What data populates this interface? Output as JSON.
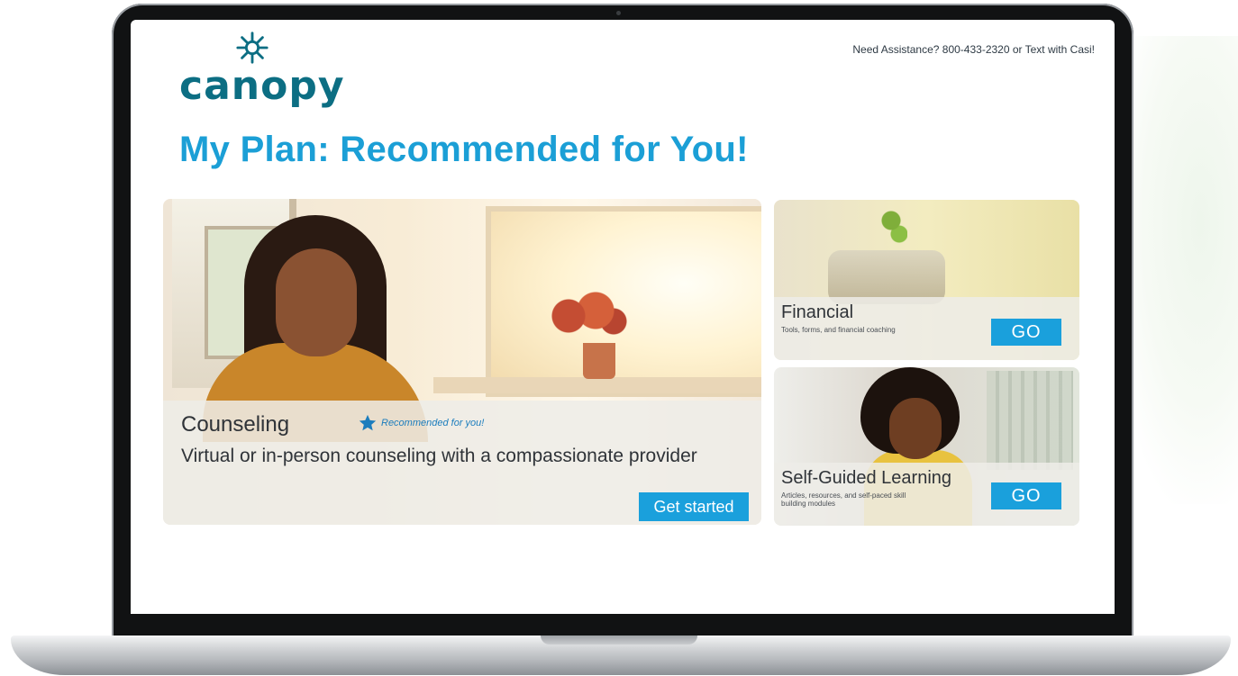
{
  "header": {
    "brand": "canopy",
    "assistance": "Need Assistance? 800-433-2320 or Text with Casi!"
  },
  "page_title": "My Plan: Recommended for You!",
  "cards": {
    "counseling": {
      "title": "Counseling",
      "badge": "Recommended for you!",
      "description": "Virtual or in-person counseling with a compassionate provider",
      "button": "Get started"
    },
    "financial": {
      "title": "Financial",
      "description": "Tools, forms, and financial coaching",
      "button": "GO"
    },
    "self_guided": {
      "title": "Self-Guided Learning",
      "description": "Articles, resources, and self-paced skill building modules",
      "button": "GO"
    }
  },
  "icons": {
    "logo": "canopy-logo-icon",
    "badge": "star-icon"
  },
  "colors": {
    "brand_teal": "#0c6e83",
    "title_blue": "#1b9fd6",
    "button_blue": "#1aa0dc"
  }
}
